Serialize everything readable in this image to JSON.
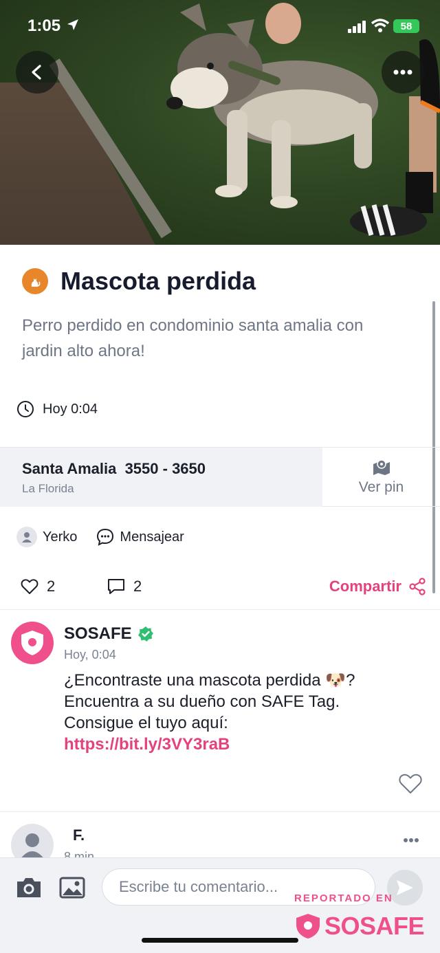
{
  "status_bar": {
    "time": "1:05",
    "battery": "58"
  },
  "post": {
    "category_icon": "cat-icon",
    "title": "Mascota perdida",
    "description": "Perro perdido en condominio santa amalia con jardin alto ahora!",
    "timestamp": "Hoy 0:04",
    "location": {
      "street": "Santa Amalia  3550 - 3650",
      "city": "La Florida",
      "pin_label": "Ver pin"
    },
    "author": "Yerko",
    "message_label": "Mensajear",
    "likes": "2",
    "comments": "2",
    "share_label": "Compartir"
  },
  "comments": [
    {
      "author": "SOSAFE",
      "verified": true,
      "time": "Hoy, 0:04",
      "text": "¿Encontraste una mascota perdida 🐶? Encuentra a su dueño con SAFE Tag. Consigue el tuyo aquí: ",
      "link": "https://bit.ly/3VY3raB"
    },
    {
      "author": "F.",
      "time": "8 min"
    }
  ],
  "composer": {
    "placeholder": "Escribe tu comentario..."
  },
  "watermark": {
    "label": "REPORTADO EN",
    "brand": "SOSAFE"
  },
  "colors": {
    "accent": "#e4427d",
    "brand": "#ef4f8b",
    "category": "#e8862b",
    "verified": "#2fbf71"
  }
}
